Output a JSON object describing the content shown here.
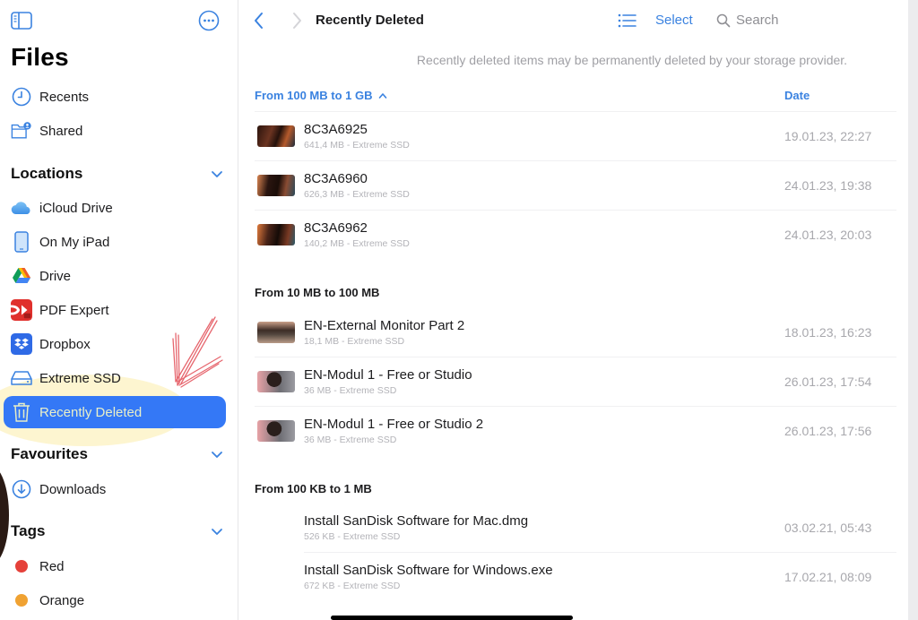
{
  "sidebar": {
    "title": "Files",
    "top_items": [
      {
        "label": "Recents",
        "icon": "clock-icon"
      },
      {
        "label": "Shared",
        "icon": "shared-folder-icon"
      }
    ],
    "sections": {
      "locations": {
        "header": "Locations",
        "items": [
          {
            "label": "iCloud Drive",
            "icon": "icloud-icon"
          },
          {
            "label": "On My iPad",
            "icon": "ipad-icon"
          },
          {
            "label": "Drive",
            "icon": "google-drive-icon"
          },
          {
            "label": "PDF Expert",
            "icon": "pdf-expert-icon"
          },
          {
            "label": "Dropbox",
            "icon": "dropbox-icon"
          },
          {
            "label": "Extreme SSD",
            "icon": "external-drive-icon"
          },
          {
            "label": "Recently Deleted",
            "icon": "trash-icon",
            "selected": true
          }
        ]
      },
      "favourites": {
        "header": "Favourites",
        "items": [
          {
            "label": "Downloads",
            "icon": "download-icon"
          }
        ]
      },
      "tags": {
        "header": "Tags",
        "items": [
          {
            "label": "Red",
            "color": "#e5413a"
          },
          {
            "label": "Orange",
            "color": "#f0a232"
          }
        ]
      }
    }
  },
  "toolbar": {
    "title": "Recently Deleted",
    "select_label": "Select",
    "search_label": "Search"
  },
  "notice": "Recently deleted items may be permanently deleted by your storage provider.",
  "list": {
    "group_sort_label": "From 100 MB to 1 GB",
    "date_column": "Date",
    "groups": [
      {
        "label": "From 100 MB to 1 GB",
        "files": [
          {
            "name": "8C3A6925",
            "meta": "641,4 MB - Extreme SSD",
            "date": "19.01.23, 22:27"
          },
          {
            "name": "8C3A6960",
            "meta": "626,3 MB - Extreme SSD",
            "date": "24.01.23, 19:38"
          },
          {
            "name": "8C3A6962",
            "meta": "140,2 MB - Extreme SSD",
            "date": "24.01.23, 20:03"
          }
        ]
      },
      {
        "label": "From 10 MB to 100 MB",
        "files": [
          {
            "name": "EN-External Monitor Part 2",
            "meta": "18,1 MB - Extreme SSD",
            "date": "18.01.23, 16:23"
          },
          {
            "name": "EN-Modul 1 - Free or Studio",
            "meta": "36 MB - Extreme SSD",
            "date": "26.01.23, 17:54"
          },
          {
            "name": "EN-Modul 1 - Free or Studio 2",
            "meta": "36 MB - Extreme SSD",
            "date": "26.01.23, 17:56"
          }
        ]
      },
      {
        "label": "From 100 KB to 1 MB",
        "files": [
          {
            "name": "Install SanDisk Software for Mac.dmg",
            "meta": "526 KB - Extreme SSD",
            "date": "03.02.21, 05:43"
          },
          {
            "name": "Install SanDisk Software for Windows.exe",
            "meta": "672 KB - Extreme SSD",
            "date": "17.02.21, 08:09"
          }
        ]
      }
    ]
  },
  "colors": {
    "accent": "#3a82e0",
    "selection": "#3478f6",
    "secondary_text": "#a8a8ad"
  }
}
